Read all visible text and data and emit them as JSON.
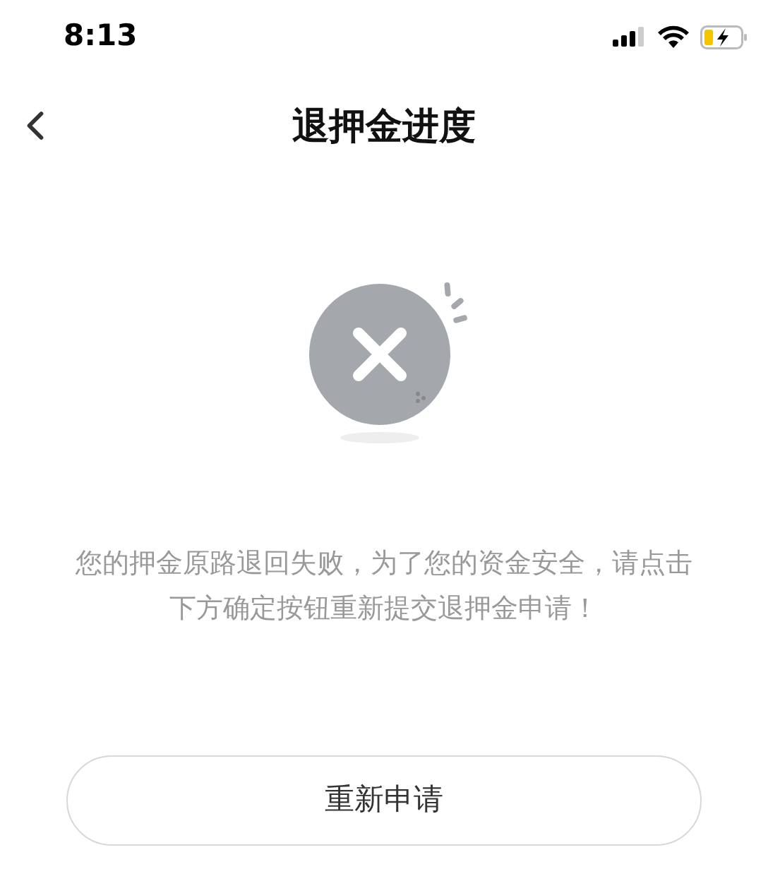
{
  "status_bar": {
    "time": "8:13"
  },
  "nav": {
    "title": "退押金进度"
  },
  "message": "您的押金原路退回失败，为了您的资金安全，请点击下方确定按钮重新提交退押金申请！",
  "button": "重新申请"
}
